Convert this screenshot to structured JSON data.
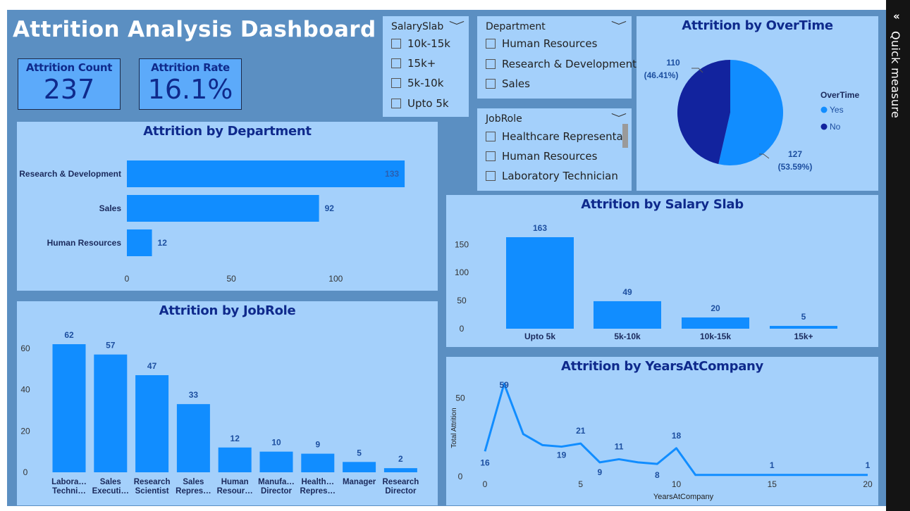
{
  "dashboard": {
    "title": "Attrition Analysis Dashboard"
  },
  "kpis": {
    "attrition_count": {
      "label": "Attrition Count",
      "value": "237"
    },
    "attrition_rate": {
      "label": "Attrition Rate",
      "value": "16.1%"
    }
  },
  "slicers": {
    "salary": {
      "title": "SalarySlab",
      "items": [
        "10k-15k",
        "15k+",
        "5k-10k",
        "Upto 5k"
      ]
    },
    "department": {
      "title": "Department",
      "items": [
        "Human Resources",
        "Research & Development",
        "Sales"
      ]
    },
    "jobrole": {
      "title": "JobRole",
      "items": [
        "Healthcare Representativ",
        "Human Resources",
        "Laboratory Technician"
      ]
    }
  },
  "quick_measure": {
    "label": "Quick measure",
    "icon": "chevron-left-double-icon"
  },
  "colors": {
    "bar": "#118dff",
    "yes": "#118dff",
    "no": "#12239e",
    "title": "#0f2a8c",
    "panel": "#a4d0fb",
    "canvas": "#5b8fc2"
  },
  "chart_data": [
    {
      "id": "department",
      "type": "bar",
      "orientation": "horizontal",
      "title": "Attrition by Department",
      "categories": [
        "Research & Development",
        "Sales",
        "Human Resources"
      ],
      "values": [
        133,
        92,
        12
      ],
      "xticks": [
        "0",
        "50",
        "100"
      ],
      "xlim": [
        0,
        135
      ]
    },
    {
      "id": "overtime",
      "type": "pie",
      "title": "Attrition by OverTime",
      "legend_title": "OverTime",
      "legend_position": "right",
      "categories": [
        "Yes",
        "No"
      ],
      "values": [
        127,
        110
      ],
      "labels": [
        "127",
        "110"
      ],
      "percent_labels": [
        "(53.59%)",
        "(46.41%)"
      ]
    },
    {
      "id": "salary",
      "type": "bar",
      "title": "Attrition by Salary Slab",
      "categories": [
        "Upto 5k",
        "5k-10k",
        "10k-15k",
        "15k+"
      ],
      "values": [
        163,
        49,
        20,
        5
      ],
      "yticks": [
        "0",
        "50",
        "100",
        "150"
      ],
      "ylim": [
        0,
        163
      ]
    },
    {
      "id": "jobrole",
      "type": "bar",
      "title": "Attrition by JobRole",
      "categories": [
        [
          "Labora…",
          "Techni…"
        ],
        [
          "Sales",
          "Executi…"
        ],
        [
          "Research",
          "Scientist"
        ],
        [
          "Sales",
          "Repres…"
        ],
        [
          "Human",
          "Resour…"
        ],
        [
          "Manufa…",
          "Director"
        ],
        [
          "Health…",
          "Repres…"
        ],
        [
          "Manager"
        ],
        [
          "Research",
          "Director"
        ]
      ],
      "values": [
        62,
        57,
        47,
        33,
        12,
        10,
        9,
        5,
        2
      ],
      "yticks": [
        "0",
        "20",
        "40",
        "60"
      ],
      "ylim": [
        0,
        62
      ]
    },
    {
      "id": "years",
      "type": "line",
      "title": "Attrition by YearsAtCompany",
      "xlabel": "YearsAtCompany",
      "ylabel": "Total Attrition",
      "x": [
        0,
        1,
        2,
        3,
        4,
        5,
        6,
        7,
        8,
        9,
        10,
        11,
        12,
        13,
        14,
        15,
        16,
        17,
        18,
        19,
        20
      ],
      "y": [
        16,
        59,
        27,
        20,
        19,
        21,
        9,
        11,
        9,
        8,
        18,
        1,
        1,
        1,
        1,
        1,
        1,
        1,
        1,
        1,
        1
      ],
      "point_labels": [
        {
          "x": 0,
          "label": "16"
        },
        {
          "x": 1,
          "label": "59"
        },
        {
          "x": 4,
          "label": "19"
        },
        {
          "x": 5,
          "label": "21"
        },
        {
          "x": 6,
          "label": "9"
        },
        {
          "x": 7,
          "label": "11"
        },
        {
          "x": 9,
          "label": "8"
        },
        {
          "x": 10,
          "label": "18"
        },
        {
          "x": 15,
          "label": "1"
        },
        {
          "x": 20,
          "label": "1"
        }
      ],
      "xticks": [
        "0",
        "5",
        "10",
        "15",
        "20"
      ],
      "yticks": [
        "0",
        "50"
      ],
      "xlim": [
        0,
        20
      ],
      "ylim": [
        0,
        60
      ]
    }
  ]
}
